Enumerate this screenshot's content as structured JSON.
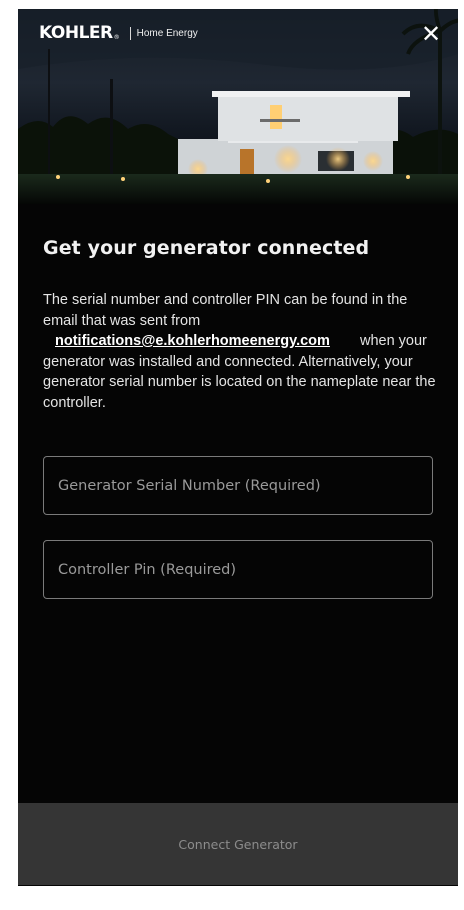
{
  "brand": {
    "logo": "KOHLER",
    "logo_mark": "®",
    "subtitle": "Home Energy"
  },
  "header": {
    "close_glyph": "✕"
  },
  "content": {
    "title": "Get your generator connected",
    "description_part1": "The serial number and controller PIN can be found in the email that was sent from",
    "email_link": "notifications@e.kohlerhomeenergy.com",
    "description_part2": "when your generator was installed and connected. Alternatively, your generator serial number is located on the nameplate near the controller."
  },
  "form": {
    "serial": {
      "placeholder": "Generator Serial Number (Required)",
      "value": ""
    },
    "pin": {
      "placeholder": "Controller Pin (Required)",
      "value": ""
    }
  },
  "footer": {
    "connect_label": "Connect Generator"
  },
  "colors": {
    "background": "#050505",
    "footer_button": "#353535",
    "text_primary": "#f2f2f2",
    "field_border": "#7a7a7a"
  }
}
